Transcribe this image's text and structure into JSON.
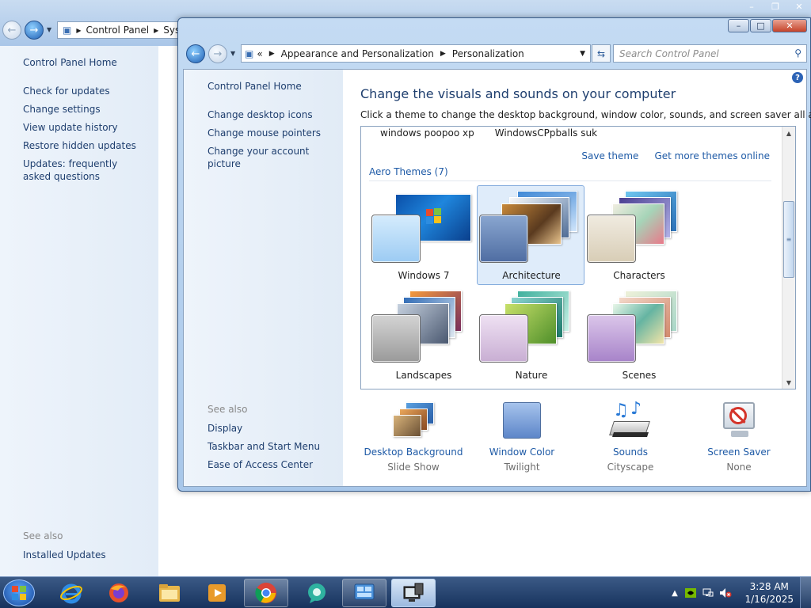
{
  "bg_window": {
    "breadcrumb": [
      "Control Panel",
      "Sys"
    ],
    "left_links": [
      "Control Panel Home",
      "Check for updates",
      "Change settings",
      "View update history",
      "Restore hidden updates",
      "Updates: frequently asked questions"
    ],
    "see_also_label": "See also",
    "see_also_links": [
      "Installed Updates"
    ]
  },
  "window": {
    "breadcrumb_prefix": "«",
    "breadcrumb": [
      "Appearance and Personalization",
      "Personalization"
    ],
    "search_placeholder": "Search Control Panel",
    "help_label": "?",
    "left": {
      "home": "Control Panel Home",
      "links": [
        "Change desktop icons",
        "Change mouse pointers",
        "Change your account picture"
      ],
      "see_also_label": "See also",
      "see_also_links": [
        "Display",
        "Taskbar and Start Menu",
        "Ease of Access Center"
      ]
    },
    "title": "Change the visuals and sounds on your computer",
    "description": "Click a theme to change the desktop background, window color, sounds, and screen saver all at once.",
    "my_themes": [
      "windows poopoo xp",
      "WindowsCPpballs suk"
    ],
    "save_theme": "Save theme",
    "get_more_themes": "Get more themes online",
    "aero_header": "Aero Themes (7)",
    "themes": [
      {
        "name": "Windows 7",
        "selected": false
      },
      {
        "name": "Architecture",
        "selected": true
      },
      {
        "name": "Characters",
        "selected": false
      },
      {
        "name": "Landscapes",
        "selected": false
      },
      {
        "name": "Nature",
        "selected": false
      },
      {
        "name": "Scenes",
        "selected": false
      }
    ],
    "bottom_items": [
      {
        "label": "Desktop Background",
        "value": "Slide Show",
        "icon": "desktop-background-icon"
      },
      {
        "label": "Window Color",
        "value": "Twilight",
        "icon": "window-color-icon"
      },
      {
        "label": "Sounds",
        "value": "Cityscape",
        "icon": "sounds-icon"
      },
      {
        "label": "Screen Saver",
        "value": "None",
        "icon": "screen-saver-icon"
      }
    ]
  },
  "taskbar": {
    "pinned": [
      {
        "name": "internet-explorer",
        "state": "pinned"
      },
      {
        "name": "firefox",
        "state": "pinned"
      },
      {
        "name": "file-explorer",
        "state": "pinned"
      },
      {
        "name": "media-player",
        "state": "pinned"
      },
      {
        "name": "chrome",
        "state": "open"
      },
      {
        "name": "chat-app",
        "state": "pinned"
      },
      {
        "name": "control-panel",
        "state": "open"
      },
      {
        "name": "remote-desktop",
        "state": "active"
      }
    ],
    "time": "3:28 AM",
    "date": "1/16/2025"
  }
}
